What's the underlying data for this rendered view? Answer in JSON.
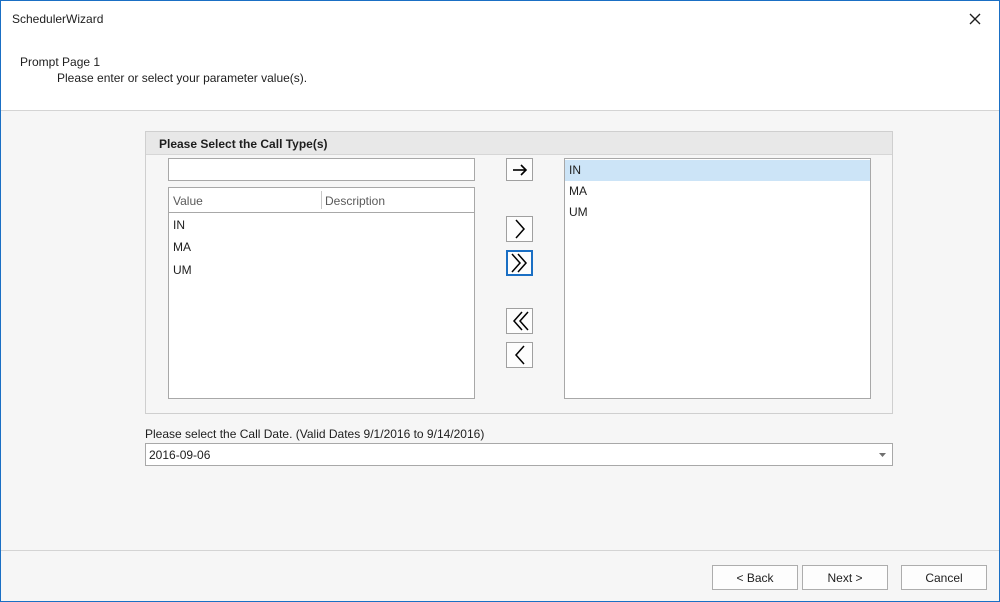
{
  "window": {
    "title": "SchedulerWizard",
    "close_icon": "close-icon"
  },
  "header": {
    "heading": "Prompt Page 1",
    "subheading": "Please enter or select your parameter value(s)."
  },
  "call_type": {
    "group_title": "Please Select the Call Type(s)",
    "filter_value": "",
    "available": {
      "columns": [
        "Value",
        "Description"
      ],
      "rows": [
        "IN",
        "MA",
        "UM"
      ]
    },
    "selected": {
      "rows": [
        "IN",
        "MA",
        "UM"
      ],
      "highlighted_index": 0
    },
    "buttons": {
      "insert_text": "arrow-right-icon",
      "add": "chevron-right-icon",
      "add_all": "double-chevron-right-icon",
      "remove_all": "double-chevron-left-icon",
      "remove": "chevron-left-icon"
    }
  },
  "call_date": {
    "label": "Please select the Call Date. (Valid Dates 9/1/2016 to 9/14/2016)",
    "value": "2016-09-06"
  },
  "footer": {
    "back_label": "< Back",
    "next_label": "Next >",
    "cancel_label": "Cancel"
  },
  "colors": {
    "accent": "#1a6fc4",
    "selection": "#cce4f7"
  }
}
